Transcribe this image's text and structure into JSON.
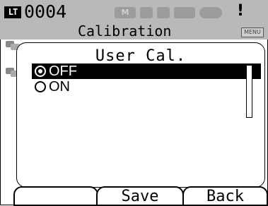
{
  "statusbar": {
    "mode_icon": "LT",
    "sample_number": "0004",
    "status_icons": [
      "M",
      "",
      "",
      "",
      ""
    ],
    "alert": "!",
    "title": "Calibration",
    "menu_tag": "MENU"
  },
  "dialog": {
    "title": "User Cal.",
    "options": [
      {
        "label": "OFF",
        "selected": true
      },
      {
        "label": "ON",
        "selected": false
      }
    ]
  },
  "softkeys": [
    "",
    "Save",
    "Back"
  ],
  "colors": {
    "statusbar": "#b9b9b9",
    "highlight": "#000000"
  }
}
